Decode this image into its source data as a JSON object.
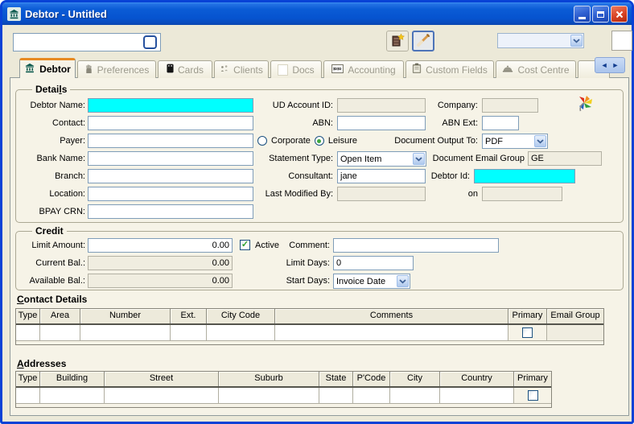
{
  "window": {
    "title": "Debtor - Untitled"
  },
  "colors": {
    "field_highlight": "#00FFFF",
    "titlebar_blue": "#0653CF",
    "window_border": "#0842D6",
    "active_tab_accent": "#E78A23",
    "check_green": "#2DA12D",
    "client_background": "#ECE9D8",
    "page_background": "#F6F3E7"
  },
  "icons": {
    "window_icon": "bank-building",
    "check": "✓",
    "scroll_left": "◄",
    "scroll_right": "►",
    "new_record_button": "cabinet-with-star",
    "edit_button": "paintbrush",
    "details_corner": "rainbow-pinwheel",
    "tab_icons": [
      "bank-building",
      "hand",
      "black-card",
      "people",
      "blank-page",
      "binary-box",
      "clipboard",
      "dome-cloche"
    ]
  },
  "toolbar": {
    "search_value": "",
    "combo_value": ""
  },
  "tabs": [
    {
      "label": "Debtor",
      "active": true
    },
    {
      "label": "Preferences",
      "active": false
    },
    {
      "label": "Cards",
      "active": false
    },
    {
      "label": "Clients",
      "active": false
    },
    {
      "label": "Docs",
      "active": false
    },
    {
      "label": "Accounting",
      "active": false
    },
    {
      "label": "Custom Fields",
      "active": false
    },
    {
      "label": "Cost Centre",
      "active": false
    }
  ],
  "details": {
    "title": "Details",
    "debtor_name_label": "Debtor Name:",
    "debtor_name_value": "",
    "contact_label": "Contact:",
    "contact_value": "",
    "payer_label": "Payer:",
    "payer_value": "",
    "bank_name_label": "Bank Name:",
    "bank_name_value": "",
    "branch_label": "Branch:",
    "branch_value": "",
    "location_label": "Location:",
    "location_value": "",
    "bpay_crn_label": "BPAY CRN:",
    "bpay_crn_value": "",
    "ud_account_id_label": "UD Account ID:",
    "ud_account_id_value": "",
    "abn_label": "ABN:",
    "abn_value": "",
    "corporate_label": "Corporate",
    "leisure_label": "Leisure",
    "customer_type_selected": "Leisure",
    "statement_type_label": "Statement Type:",
    "statement_type_value": "Open Item",
    "consultant_label": "Consultant:",
    "consultant_value": "jane",
    "last_modified_by_label": "Last Modified By:",
    "last_modified_by_value": "",
    "company_label": "Company:",
    "company_value": "",
    "abn_ext_label": "ABN Ext:",
    "abn_ext_value": "",
    "document_output_to_label": "Document Output To:",
    "document_output_to_value": "PDF",
    "document_email_group_label": "Document Email Group",
    "document_email_group_value": "GE",
    "debtor_id_label": "Debtor Id:",
    "debtor_id_value": "",
    "on_label": "on",
    "on_value": ""
  },
  "credit": {
    "title": "Credit",
    "limit_amount_label": "Limit Amount:",
    "limit_amount_value": "0.00",
    "current_bal_label": "Current Bal.:",
    "current_bal_value": "0.00",
    "available_bal_label": "Available Bal.:",
    "available_bal_value": "0.00",
    "active_label": "Active",
    "active_checked": true,
    "comment_label": "Comment:",
    "comment_value": "",
    "limit_days_label": "Limit Days:",
    "limit_days_value": "0",
    "start_days_label": "Start Days:",
    "start_days_value": "Invoice Date"
  },
  "contact_details": {
    "title": "Contact Details",
    "headers": [
      "Type",
      "Area",
      "Number",
      "Ext.",
      "City Code",
      "Comments",
      "Primary",
      "Email Group"
    ],
    "row": {
      "type": "",
      "area": "",
      "number": "",
      "ext": "",
      "city_code": "",
      "comments": "",
      "primary_checked": false,
      "email_group": ""
    }
  },
  "addresses": {
    "title": "Addresses",
    "headers": [
      "Type",
      "Building",
      "Street",
      "Suburb",
      "State",
      "P'Code",
      "City",
      "Country",
      "Primary"
    ],
    "row": {
      "type": "",
      "building": "",
      "street": "",
      "suburb": "",
      "state": "",
      "pcode": "",
      "city": "",
      "country": "",
      "primary_checked": false
    }
  }
}
